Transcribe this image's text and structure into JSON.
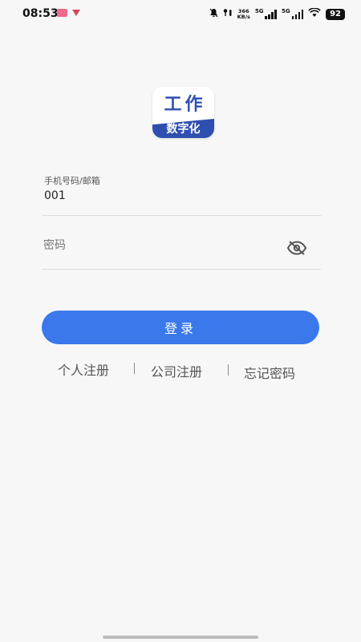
{
  "status_bar": {
    "time": "08:53",
    "net_speed_value": "366",
    "net_speed_unit": "KB/s",
    "signal_1_label": "5G",
    "signal_2_label": "5G",
    "battery": "92"
  },
  "logo": {
    "top_text": "工作",
    "bottom_text": "数字化",
    "brand_color": "#2f4fb0"
  },
  "form": {
    "account_label": "手机号码/邮箱",
    "account_value": "001",
    "password_placeholder": "密码",
    "password_toggle_icon": "eye-off-icon"
  },
  "login_button": {
    "label": "登录",
    "color": "#3a78ec"
  },
  "links": {
    "personal_register": "个人注册",
    "company_register": "公司注册",
    "forgot_password": "忘记密码",
    "separator": "|"
  }
}
